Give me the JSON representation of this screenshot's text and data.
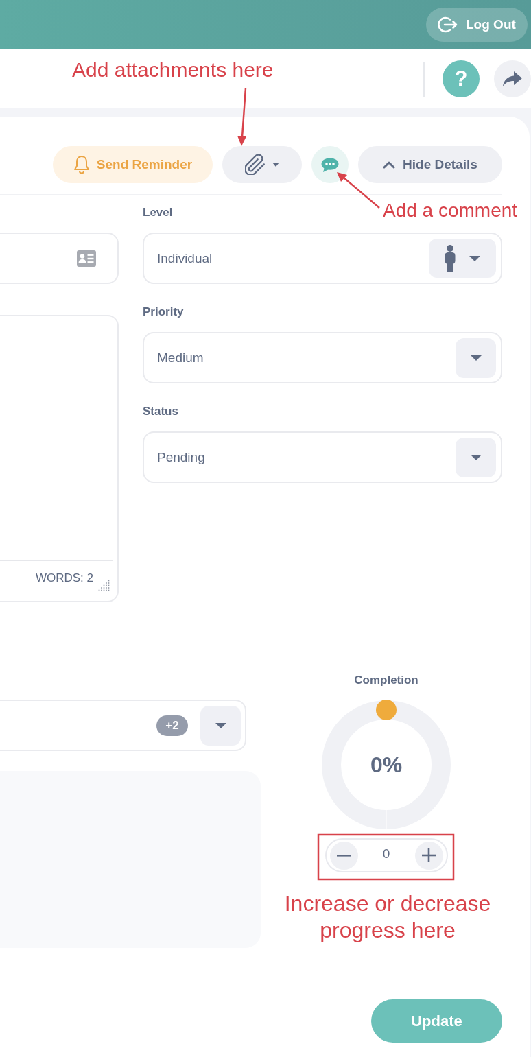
{
  "header": {
    "logout_button": {
      "label": "Log Out"
    }
  },
  "top_bar": {
    "help_button": {
      "label": "?"
    }
  },
  "toolbar": {
    "reminder_button": {
      "label": "Send Reminder"
    },
    "details_button": {
      "label": "Hide Details",
      "expanded": true
    }
  },
  "fields": [
    {
      "label": "Level",
      "value": "Individual",
      "kind": "icon_select"
    },
    {
      "label": "Priority",
      "value": "Medium",
      "kind": "select"
    },
    {
      "label": "Status",
      "value": "Pending",
      "kind": "select"
    }
  ],
  "editor": {
    "word_count": "WORDS: 2"
  },
  "multi_select": {
    "more_badge": "+2"
  },
  "completion": {
    "label": "Completion",
    "reading": "0%",
    "stepper_value": "0"
  },
  "update_button": {
    "label": "Update"
  },
  "annotations": [
    {
      "text": "Add attachments here"
    },
    {
      "text": "Add a comment"
    },
    {
      "text": "Increase or decrease progress here"
    }
  ]
}
